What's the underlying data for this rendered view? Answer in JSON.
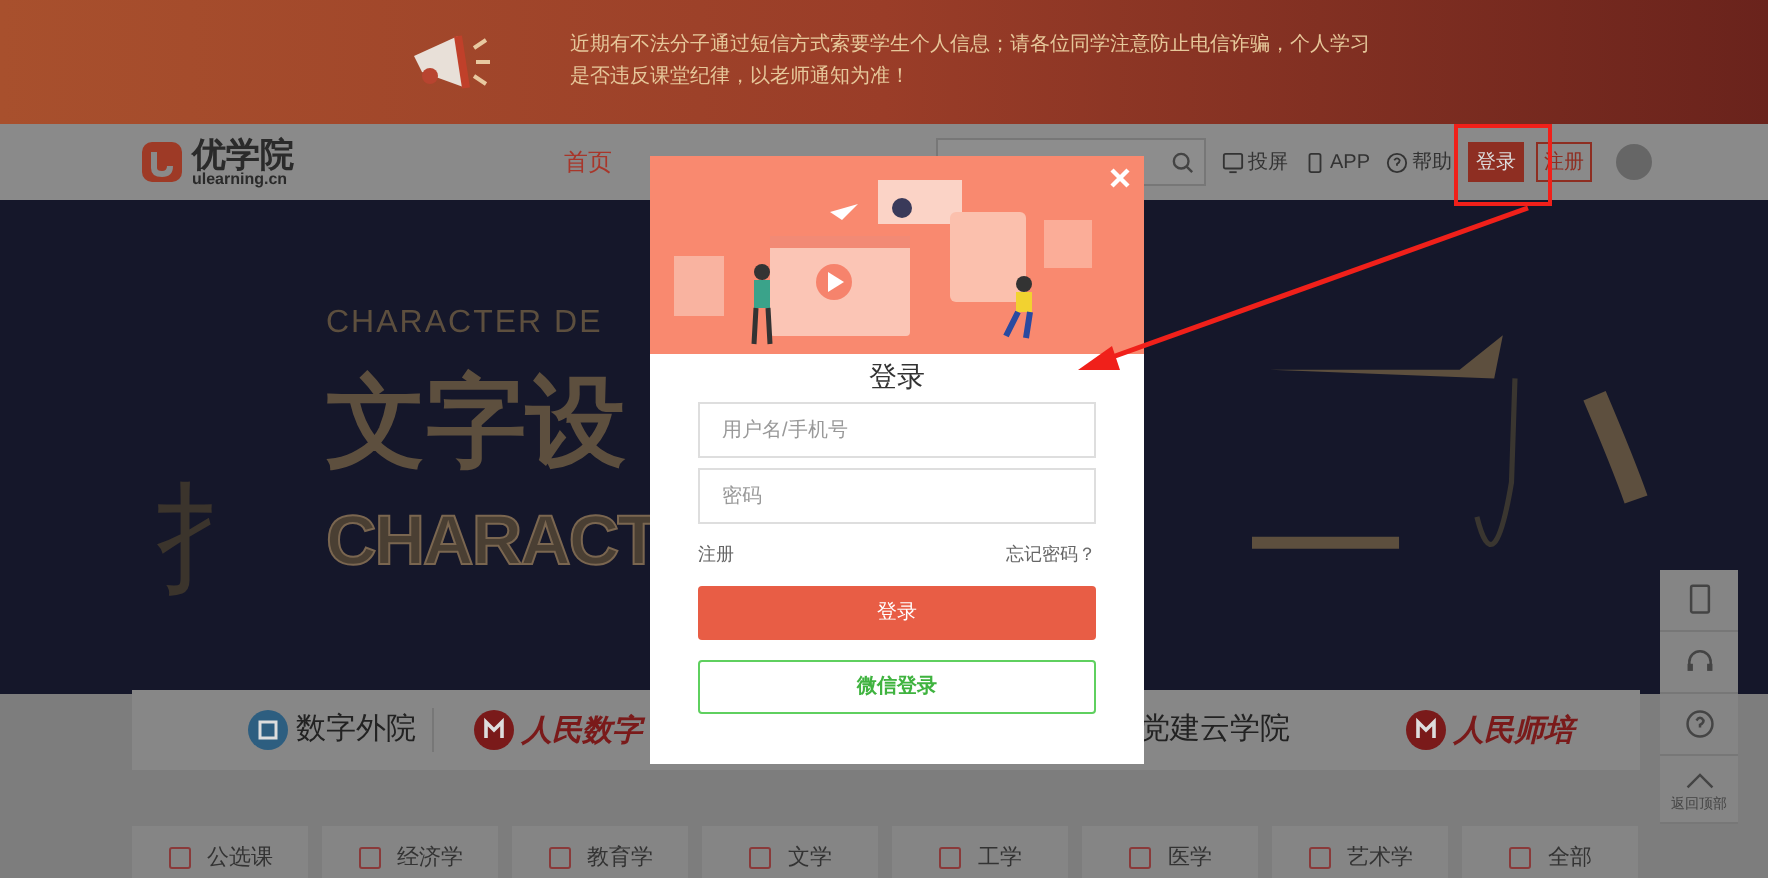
{
  "notice": {
    "lines": [
      "近期有不法分子通过短信方式索要学生个人信息；请各位同学注意防止电信诈骗，个人学习",
      "是否违反课堂纪律，以老师通知为准！"
    ]
  },
  "header": {
    "logo": {
      "name": "优学院",
      "domain": "ulearning.cn"
    },
    "nav": [
      {
        "label": "首页",
        "selected": true
      }
    ],
    "links": [
      {
        "kind": "screen",
        "label": "投屏"
      },
      {
        "kind": "app",
        "label": "APP"
      },
      {
        "kind": "help",
        "label": "帮助"
      }
    ],
    "login": "登录",
    "register": "注册"
  },
  "hero": {
    "lines": [
      "CHARACTER DE",
      "文字设",
      "CHARACT"
    ],
    "glyph": "扌"
  },
  "partners": [
    {
      "kind": "badge",
      "label": "数字外院"
    },
    {
      "kind": "seal",
      "label": "人民数字"
    },
    {
      "kind": "plain",
      "label": "党建云学院"
    },
    {
      "kind": "seal",
      "label": "人民师培"
    }
  ],
  "categories": [
    "公选课",
    "经济学",
    "教育学",
    "文学",
    "工学",
    "医学",
    "艺术学",
    "全部"
  ],
  "side_tools": [
    {
      "kind": "phone"
    },
    {
      "kind": "headset"
    },
    {
      "kind": "help"
    },
    {
      "kind": "top",
      "label": "返回顶部"
    }
  ],
  "modal": {
    "title": "登录",
    "fields": [
      {
        "placeholder": "用户名/手机号"
      },
      {
        "placeholder": "密码"
      }
    ],
    "register": "注册",
    "forgot": "忘记密码？",
    "submit": "登录",
    "wechat": "微信登录"
  }
}
